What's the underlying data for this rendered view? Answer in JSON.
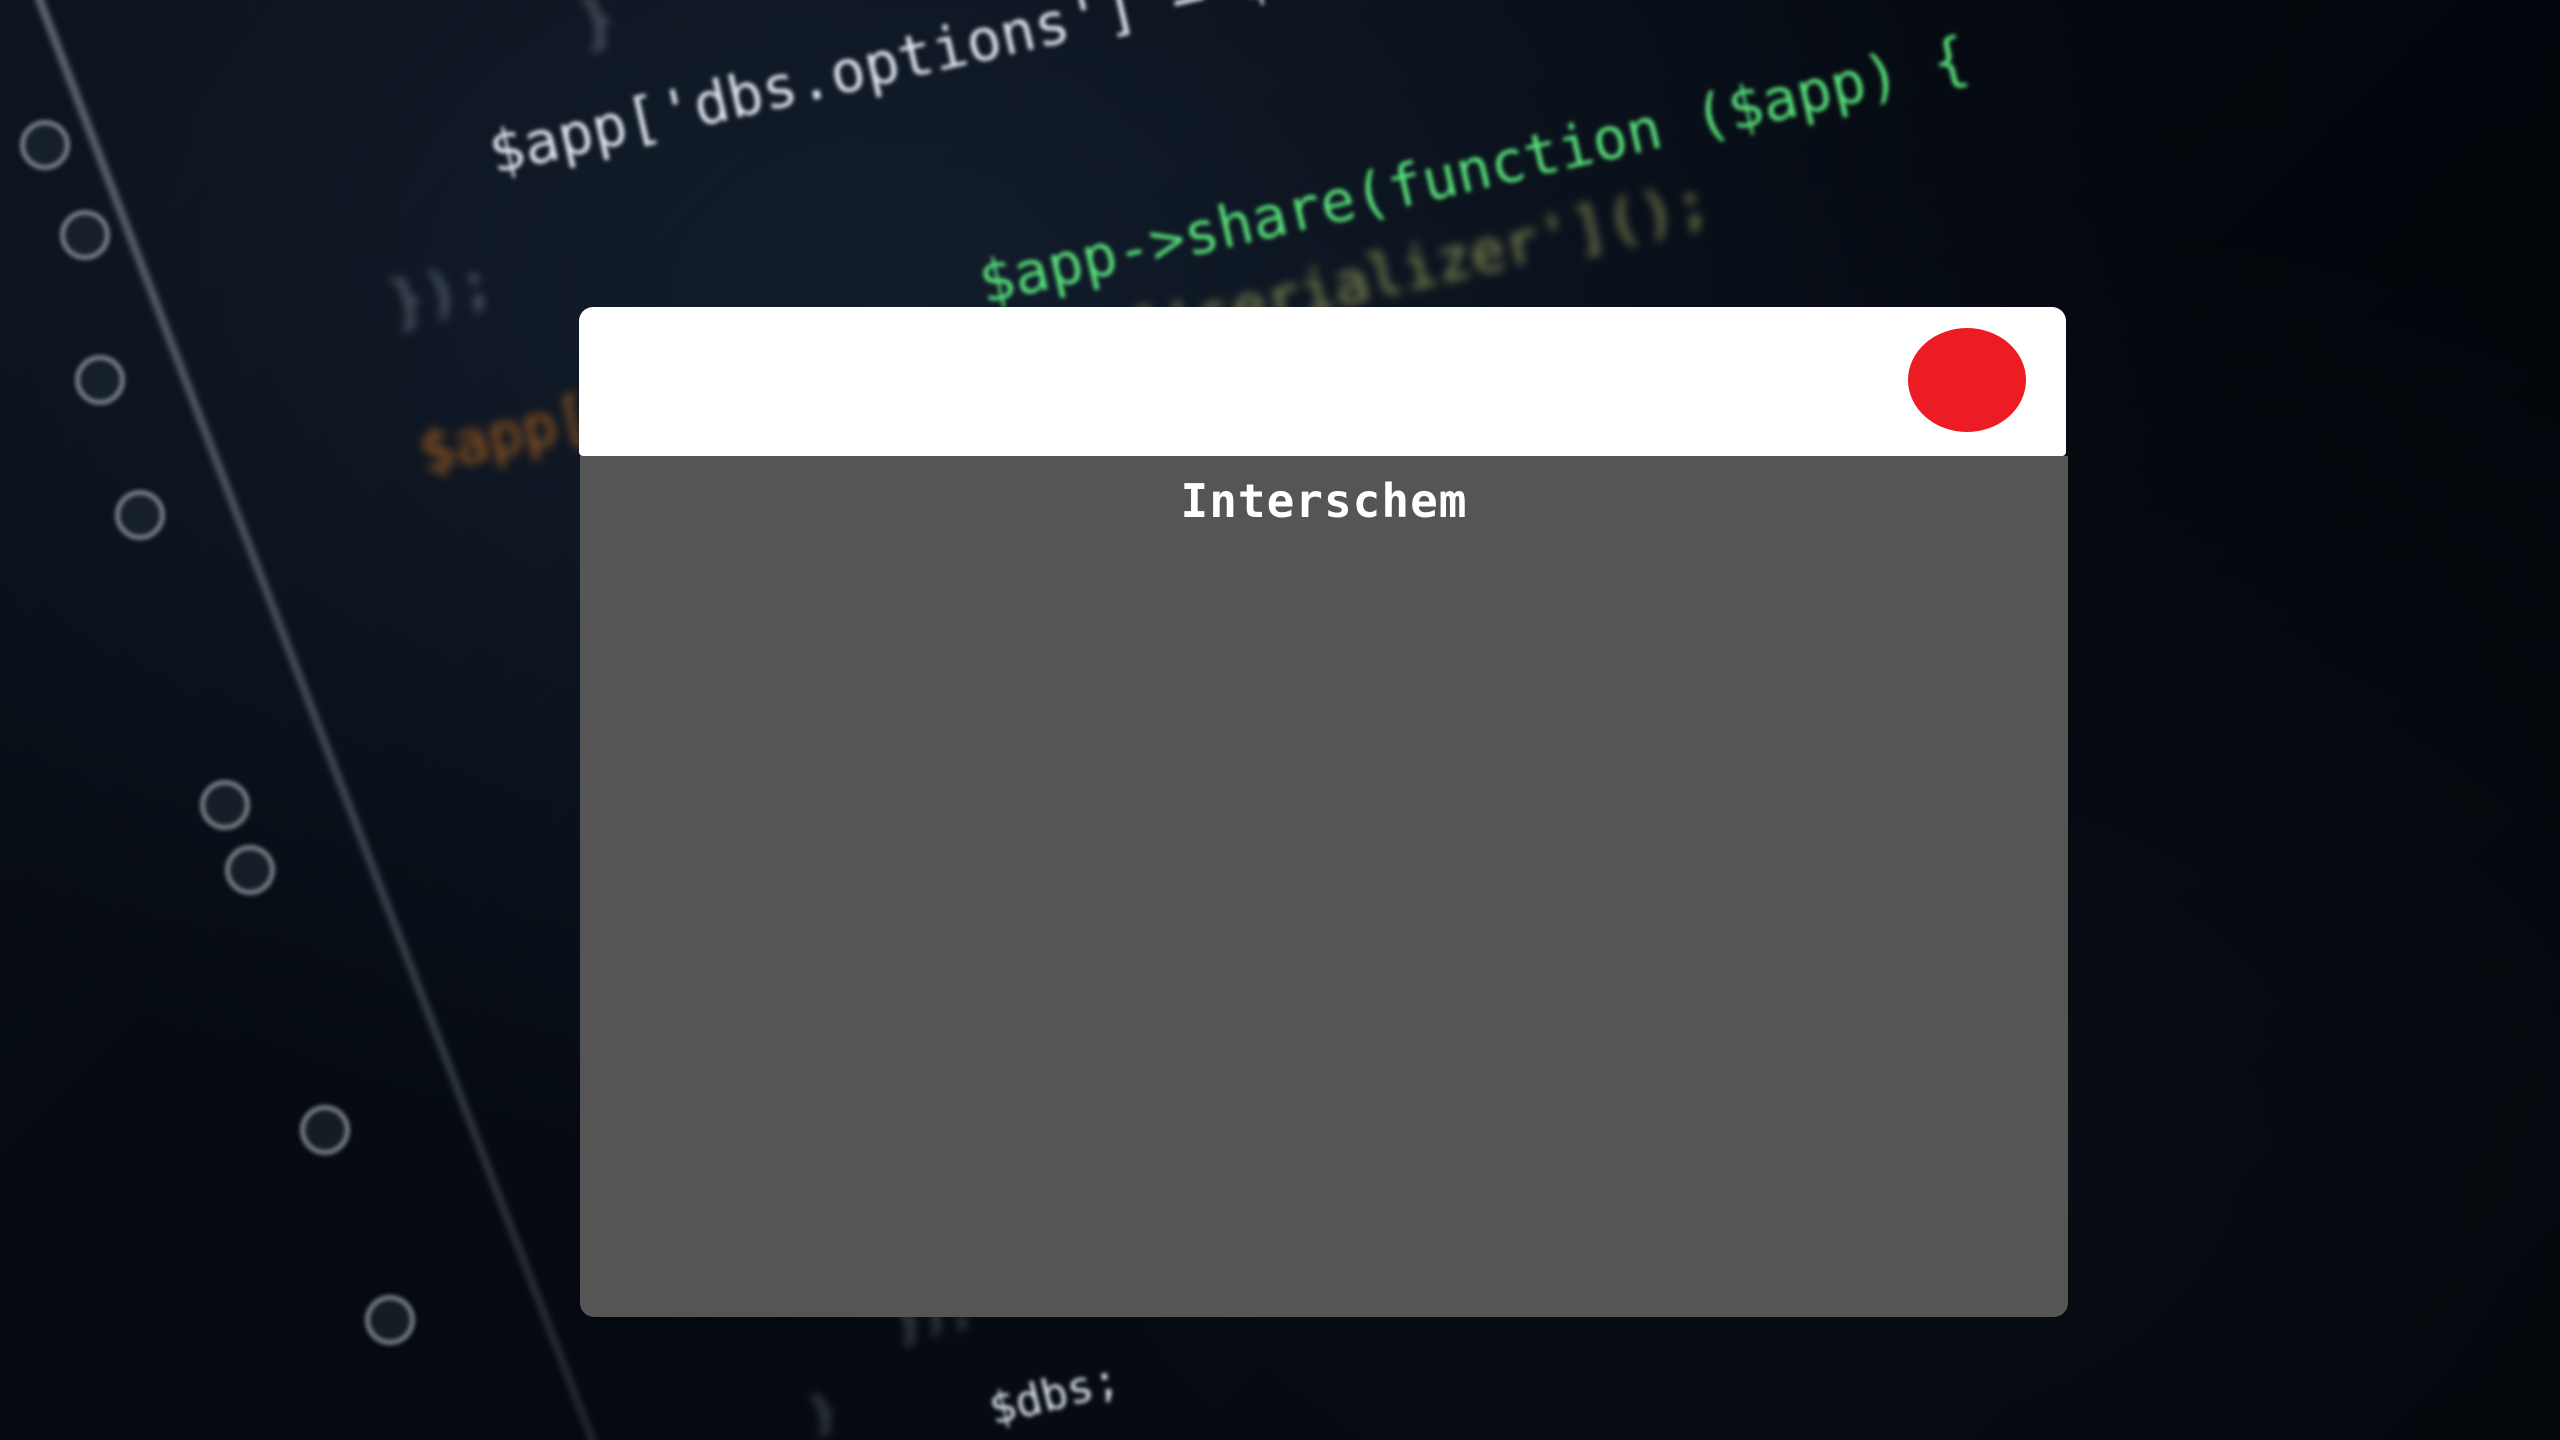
{
  "app": {
    "title": "Interschem"
  },
  "window": {
    "close_button_color": "#ed1c24",
    "titlebar_color": "#ffffff",
    "panel_color": "#555555"
  },
  "background": {
    "code_lines": [
      "$app['dbs.options'] = $tmp;",
      "$app->share(function ($app) {",
      "['serializer']();",
      "});",
      "$app[",
      "$dbs;"
    ]
  }
}
